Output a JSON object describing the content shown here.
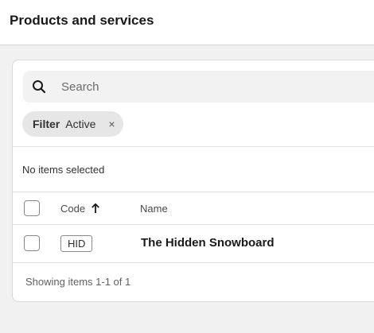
{
  "header": {
    "title": "Products and services"
  },
  "search": {
    "placeholder": "Search",
    "icon": "search-icon"
  },
  "filter": {
    "key": "Filter",
    "value": "Active",
    "remove_glyph": "×"
  },
  "selection": {
    "text": "No items selected"
  },
  "table": {
    "columns": [
      {
        "label": "Code",
        "sorted": "ascending"
      },
      {
        "label": "Name"
      }
    ],
    "rows": [
      {
        "code": "HID",
        "name": "The Hidden Snowboard",
        "selected": false
      }
    ]
  },
  "footer": {
    "text": "Showing items 1-1 of 1"
  }
}
